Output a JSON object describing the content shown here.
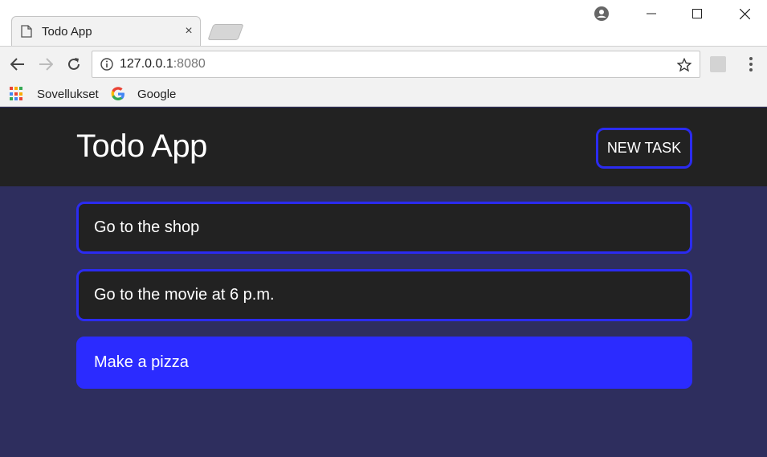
{
  "browser": {
    "tab_title": "Todo App",
    "tab_close": "×",
    "url_host": "127.0.0.1",
    "url_port": ":8080",
    "bookmarks": [
      {
        "label": "Sovellukset",
        "icon": "apps-grid-icon"
      },
      {
        "label": "Google",
        "icon": "google-icon"
      }
    ]
  },
  "header": {
    "title": "Todo App",
    "new_task_label": "NEW TASK"
  },
  "tasks": [
    {
      "label": "Go to the shop",
      "active": false
    },
    {
      "label": "Go to the movie at 6 p.m.",
      "active": false
    },
    {
      "label": "Make a pizza",
      "active": true
    }
  ],
  "colors": {
    "accent": "#2b2bf0",
    "header_bg": "#222222",
    "page_bg": "#2e2e5e",
    "active_task_bg": "#2b2bff"
  }
}
